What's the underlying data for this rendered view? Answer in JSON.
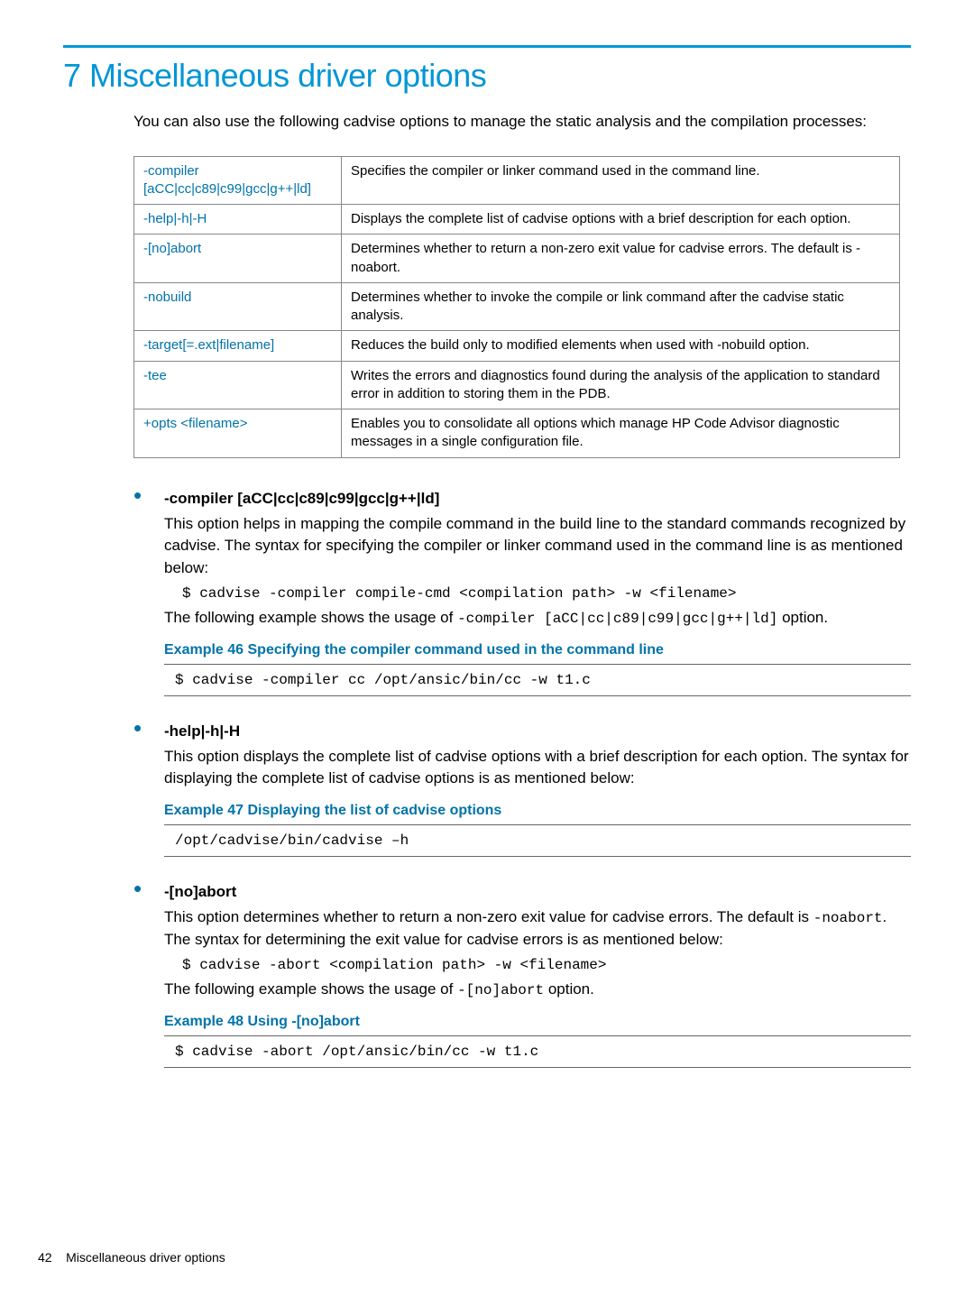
{
  "heading": "7 Miscellaneous driver options",
  "intro": "You can also use the following cadvise options to manage the static analysis and the compilation processes:",
  "table": {
    "rows": [
      {
        "opt": "-compiler [aCC|cc|c89|c99|gcc|g++|ld]",
        "desc": "Specifies the compiler or linker command used in the command line."
      },
      {
        "opt": "-help|-h|-H",
        "desc": "Displays the complete list of cadvise options with a brief description for each option."
      },
      {
        "opt": "-[no]abort",
        "desc": "Determines whether to return a non-zero exit value for cadvise errors. The default is -noabort."
      },
      {
        "opt": "-nobuild",
        "desc": "Determines whether to invoke the compile or link command after the cadvise static analysis."
      },
      {
        "opt": "-target[=.ext|filename]",
        "desc": "Reduces the build only to modified elements when used with -nobuild option."
      },
      {
        "opt": "-tee",
        "desc": "Writes the errors and diagnostics found during the analysis of the application to standard error in addition to storing them in the PDB."
      },
      {
        "opt": "+opts <filename>",
        "desc": "Enables you to consolidate all options which manage HP Code Advisor diagnostic messages in a single configuration file."
      }
    ]
  },
  "section1": {
    "title": "-compiler [aCC|cc|c89|c99|gcc|g++|ld]",
    "body": "This option helps in mapping the compile command in the build line to the standard commands recognized by cadvise. The syntax for specifying the compiler or linker command used in the command line is as mentioned below:",
    "code1": "$ cadvise -compiler compile-cmd <compilation path> -w <filename>",
    "body2a": "The following example shows the usage of ",
    "body2_code": "-compiler [aCC|cc|c89|c99|gcc|g++|ld]",
    "body2b": " option.",
    "example_hdr": "Example 46 Specifying the compiler command used in the command line",
    "example_code": "$ cadvise -compiler cc /opt/ansic/bin/cc -w t1.c"
  },
  "section2": {
    "title": "-help|-h|-H",
    "body": "This option displays the complete list of cadvise options with a brief description for each option. The syntax for displaying the complete list of cadvise options is as mentioned below:",
    "example_hdr": "Example 47 Displaying the list of cadvise options",
    "example_code": "/opt/cadvise/bin/cadvise –h"
  },
  "section3": {
    "title": "-[no]abort",
    "body_a": "This option determines whether to return a non-zero exit value for cadvise errors. The default is ",
    "body_code": "-noabort",
    "body_b": ". The syntax for determining the exit value for cadvise errors is as mentioned below:",
    "code1": "$ cadvise -abort <compilation path> -w <filename>",
    "body2a": "The following example shows the usage of ",
    "body2_code": "-[no]abort",
    "body2b": " option.",
    "example_hdr": "Example 48 Using -[no]abort",
    "example_code": "$ cadvise -abort /opt/ansic/bin/cc -w t1.c"
  },
  "footer": {
    "page": "42",
    "label": "Miscellaneous driver options"
  }
}
